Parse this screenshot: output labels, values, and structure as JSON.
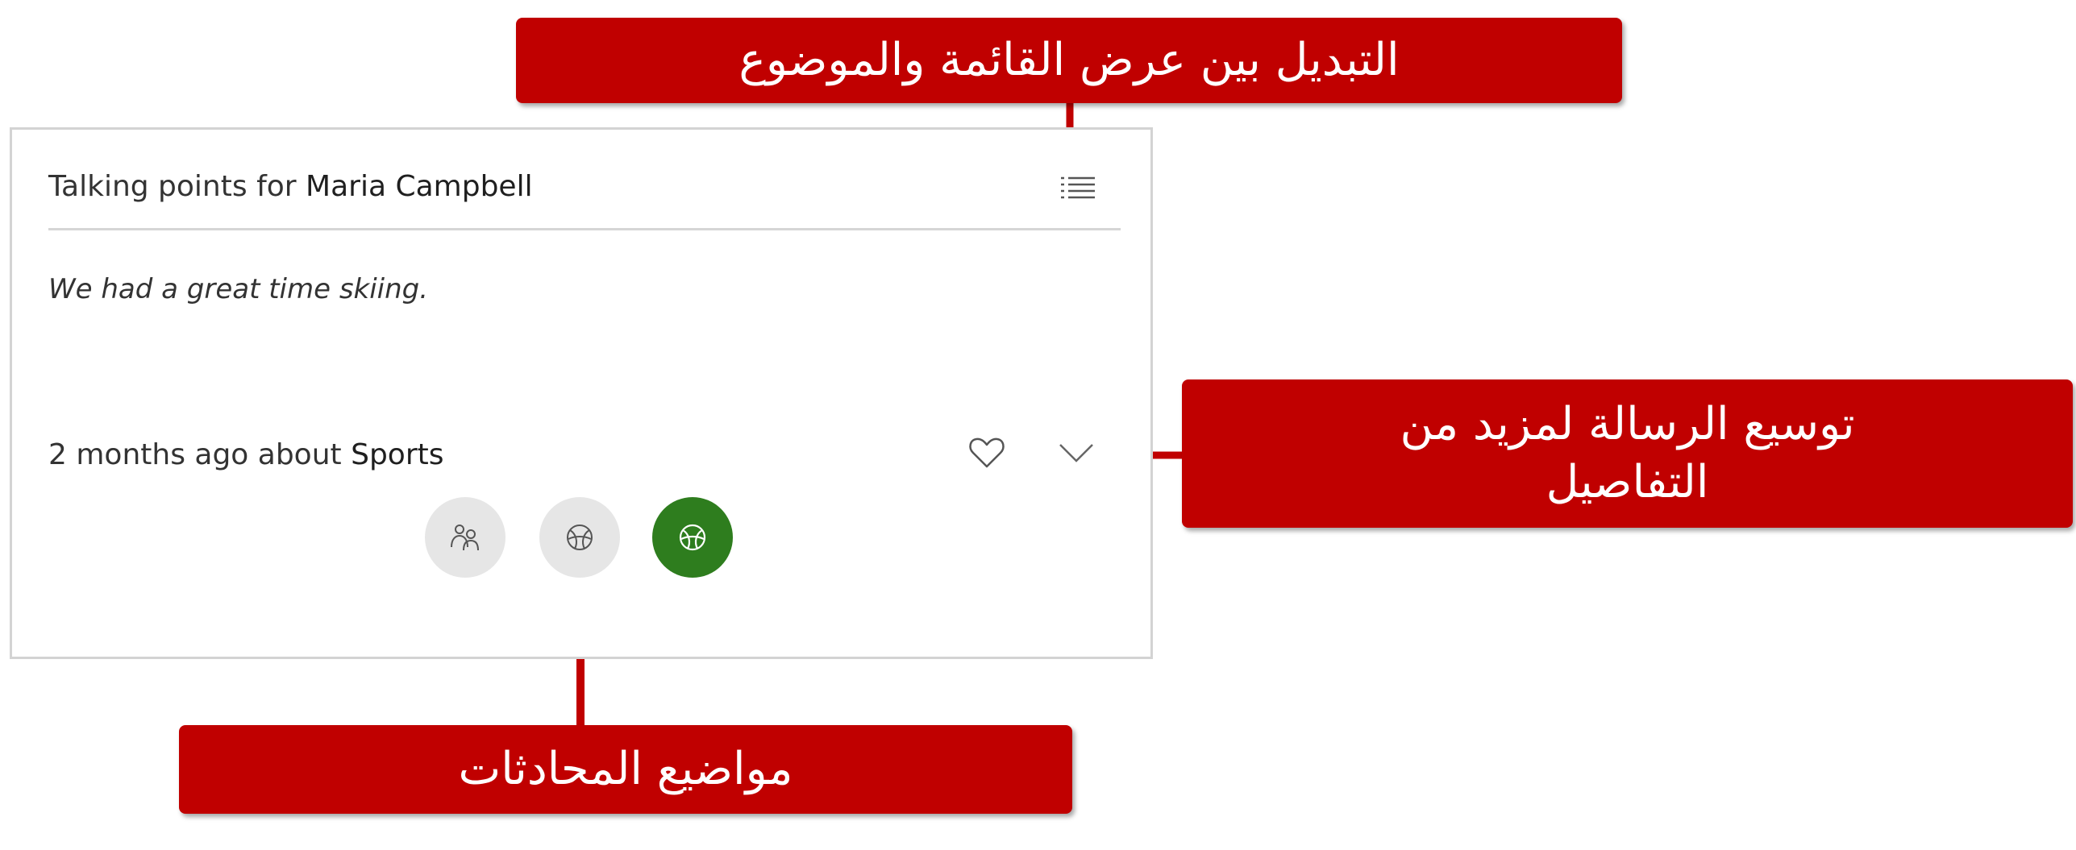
{
  "card": {
    "title_prefix": "Talking points for",
    "contact_name": "Maria Campbell",
    "message": "We had a great time skiing.",
    "time_ago": "2 months ago about",
    "topic": "Sports",
    "view_toggle_icon": "list-icon",
    "like_icon": "heart-outline-icon",
    "expand_icon": "chevron-down-icon",
    "topic_icons": [
      {
        "icon": "people-icon",
        "active": false
      },
      {
        "icon": "sports-ball-icon",
        "active": false
      },
      {
        "icon": "sports-ball-icon",
        "active": true
      }
    ],
    "active_color": "#2e7d1e"
  },
  "annotations": {
    "toggle_view": "التبديل بين عرض القائمة والموضوع",
    "expand_line1": "توسيع الرسالة لمزيد من",
    "expand_line2": "التفاصيل",
    "topics": "مواضيع المحادثات",
    "color": "#c00000"
  }
}
